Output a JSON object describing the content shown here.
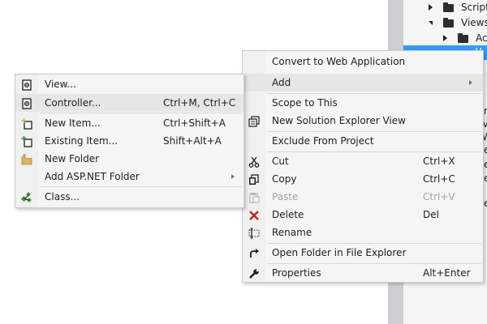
{
  "tree": {
    "scripts_label": "Scripts",
    "views_label": "Views",
    "ac_label": "Ac",
    "sel_fragment": "H",
    "fragments": [
      "r",
      "Vi",
      "W",
      "e",
      "e",
      "e",
      "e"
    ]
  },
  "main_menu": {
    "items": [
      {
        "label": "Convert to Web Application",
        "shortcut": ""
      },
      {
        "label": "Add",
        "shortcut": ""
      },
      {
        "label": "Scope to This",
        "shortcut": ""
      },
      {
        "label": "New Solution Explorer View",
        "shortcut": ""
      },
      {
        "label": "Exclude From Project",
        "shortcut": ""
      },
      {
        "label": "Cut",
        "shortcut": "Ctrl+X"
      },
      {
        "label": "Copy",
        "shortcut": "Ctrl+C"
      },
      {
        "label": "Paste",
        "shortcut": "Ctrl+V"
      },
      {
        "label": "Delete",
        "shortcut": "Del"
      },
      {
        "label": "Rename",
        "shortcut": ""
      },
      {
        "label": "Open Folder in File Explorer",
        "shortcut": ""
      },
      {
        "label": "Properties",
        "shortcut": "Alt+Enter"
      }
    ]
  },
  "sub_menu": {
    "items": [
      {
        "label": "View...",
        "shortcut": ""
      },
      {
        "label": "Controller...",
        "shortcut": "Ctrl+M, Ctrl+C"
      },
      {
        "label": "New Item...",
        "shortcut": "Ctrl+Shift+A"
      },
      {
        "label": "Existing Item...",
        "shortcut": "Shift+Alt+A"
      },
      {
        "label": "New Folder",
        "shortcut": ""
      },
      {
        "label": "Add ASP.NET Folder",
        "shortcut": ""
      },
      {
        "label": "Class...",
        "shortcut": ""
      }
    ]
  },
  "colors": {
    "delete_icon": "#c5221f",
    "add_icon": "#388a34",
    "folder_icon": "#dcb35c",
    "selection": "#3399ff"
  }
}
